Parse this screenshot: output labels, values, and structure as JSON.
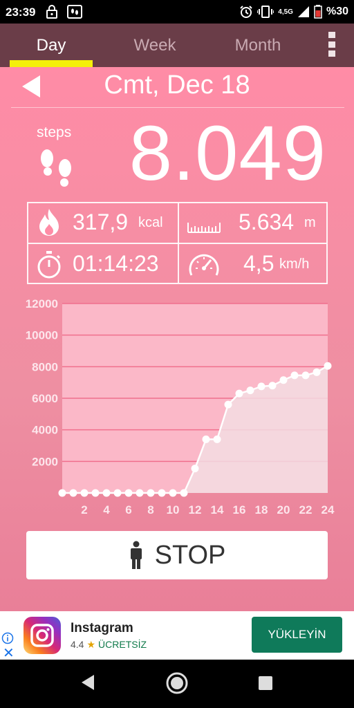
{
  "status_bar": {
    "time": "23:39",
    "network": "4,5G",
    "battery_text": "%30",
    "icons": [
      "lock-icon",
      "app-notification-icon",
      "alarm-icon",
      "vibrate-icon",
      "signal-icon",
      "battery-icon"
    ]
  },
  "tabs": [
    {
      "label": "Day",
      "active": true
    },
    {
      "label": "Week",
      "active": false
    },
    {
      "label": "Month",
      "active": false
    }
  ],
  "header": {
    "date": "Cmt, Dec 18"
  },
  "steps": {
    "label": "steps",
    "value": "8.049"
  },
  "stats": {
    "calories": {
      "value": "317,9",
      "unit": "kcal"
    },
    "distance": {
      "value": "5.634",
      "unit": "m"
    },
    "duration": {
      "value": "01:14:23"
    },
    "speed": {
      "value": "4,5",
      "unit": "km/h"
    }
  },
  "chart_data": {
    "type": "area",
    "x": [
      0,
      1,
      2,
      3,
      4,
      5,
      6,
      7,
      8,
      9,
      10,
      11,
      12,
      13,
      14,
      15,
      16,
      17,
      18,
      19,
      20,
      21,
      22,
      23,
      24
    ],
    "values": [
      0,
      0,
      0,
      0,
      0,
      0,
      0,
      0,
      0,
      0,
      0,
      0,
      1550,
      3400,
      3400,
      5600,
      6300,
      6500,
      6750,
      6800,
      7150,
      7450,
      7450,
      7650,
      8049
    ],
    "x_tick_labels": [
      "2",
      "4",
      "6",
      "8",
      "10",
      "12",
      "14",
      "16",
      "18",
      "20",
      "22",
      "24"
    ],
    "y_tick_labels": [
      "2000",
      "4000",
      "6000",
      "8000",
      "10000",
      "12000"
    ],
    "xlim": [
      0,
      24
    ],
    "ylim": [
      0,
      12000
    ],
    "grid": true,
    "colors": {
      "line": "#ffffff",
      "fill": "#f3dce2",
      "plot_bg": "#fbb8c8",
      "grid": "#f06f8d"
    }
  },
  "stop_button": {
    "label": "STOP"
  },
  "ad": {
    "title": "Instagram",
    "rating": "4.4",
    "price": "ÜCRETSİZ",
    "install_label": "YÜKLEYİN"
  }
}
